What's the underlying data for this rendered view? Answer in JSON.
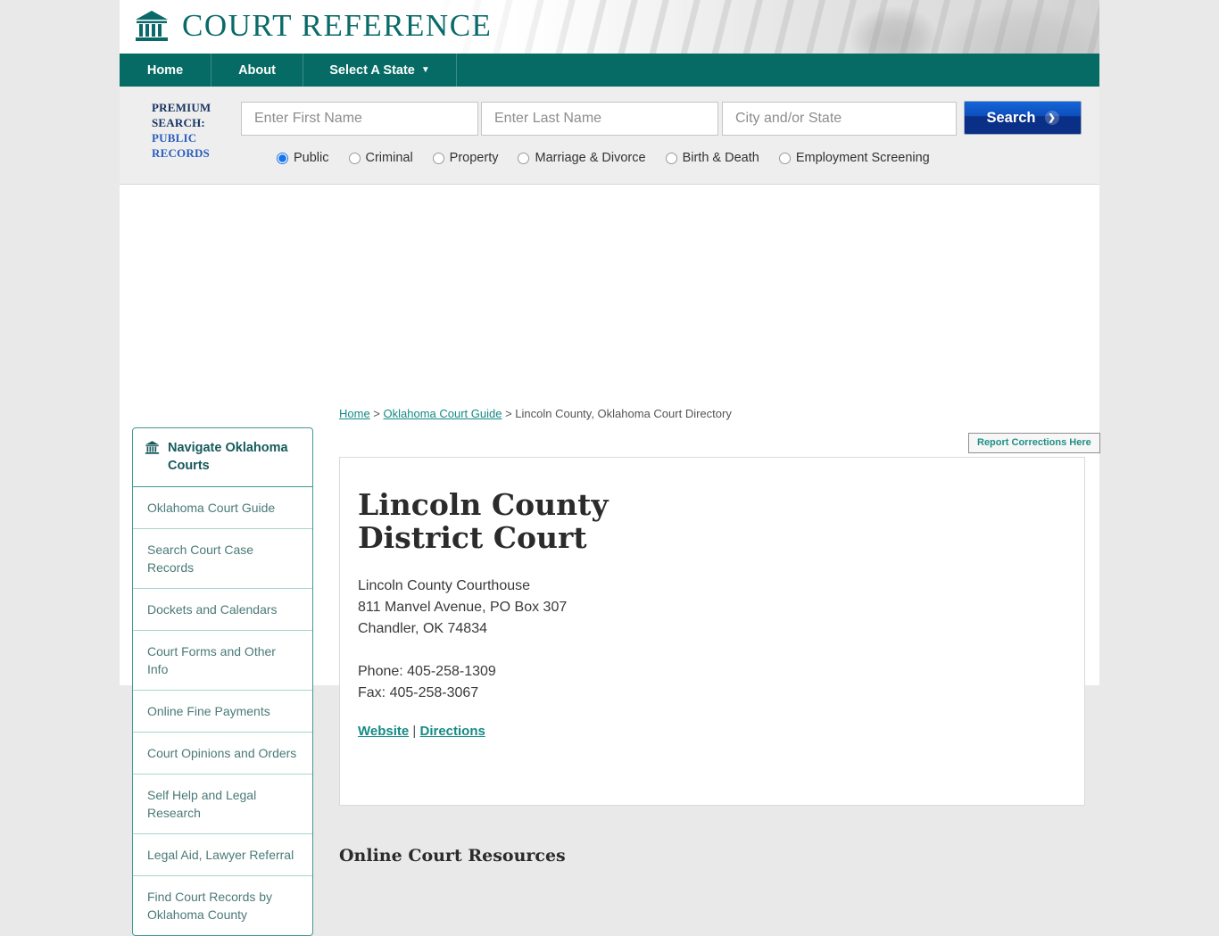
{
  "site": {
    "brand": "COURT REFERENCE",
    "brand_icon": "courthouse-icon"
  },
  "nav": {
    "items": [
      {
        "label": "Home"
      },
      {
        "label": "About"
      },
      {
        "label": "Select A State",
        "caret": "▼"
      }
    ]
  },
  "premium_search": {
    "label_line1": "PREMIUM",
    "label_line2": "SEARCH:",
    "label_line3": "PUBLIC",
    "label_line4": "RECORDS",
    "first_name_placeholder": "Enter First Name",
    "first_name_value": "",
    "last_name_placeholder": "Enter Last Name",
    "last_name_value": "",
    "city_state_placeholder": "City and/or State",
    "city_state_value": "",
    "search_button": "Search",
    "search_chevron": "❯",
    "radio_options": [
      {
        "label": "Public",
        "selected": true
      },
      {
        "label": "Criminal",
        "selected": false
      },
      {
        "label": "Property",
        "selected": false
      },
      {
        "label": "Marriage & Divorce",
        "selected": false
      },
      {
        "label": "Birth & Death",
        "selected": false
      },
      {
        "label": "Employment Screening",
        "selected": false
      }
    ],
    "accent_blue": "#2a5fbe",
    "label_navy": "#17325e"
  },
  "breadcrumb": {
    "home": "Home",
    "sep1": " > ",
    "guide": "Oklahoma Court Guide",
    "sep2": " > ",
    "current": "Lincoln County, Oklahoma Court Directory"
  },
  "sidebar": {
    "heading": "Navigate Oklahoma Courts",
    "heading_icon": "courthouse-icon",
    "items": [
      {
        "label": "Oklahoma Court Guide"
      },
      {
        "label": "Search Court Case Records"
      },
      {
        "label": "Dockets and Calendars"
      },
      {
        "label": "Court Forms and Other Info"
      },
      {
        "label": "Online Fine Payments"
      },
      {
        "label": "Court Opinions and Orders"
      },
      {
        "label": "Self Help and Legal Research"
      },
      {
        "label": "Legal Aid, Lawyer Referral"
      },
      {
        "label": "Find Court Records by Oklahoma County"
      }
    ]
  },
  "report_corrections": {
    "label": "Report Corrections Here"
  },
  "court": {
    "title": "Lincoln County District Court",
    "building": "Lincoln County Courthouse",
    "street": "811 Manvel Avenue, PO Box 307",
    "city_state_zip": "Chandler, OK 74834",
    "phone": "Phone: 405-258-1309",
    "fax": "Fax: 405-258-3067",
    "website_link": "Website",
    "link_separator": " | ",
    "directions_link": "Directions"
  },
  "main": {
    "resources_heading": "Online Court Resources"
  },
  "colors": {
    "teal": "#066b64",
    "link_teal": "#148a84",
    "page_bg": "#e9e9e9",
    "search_blue": "#0d4fbb"
  }
}
